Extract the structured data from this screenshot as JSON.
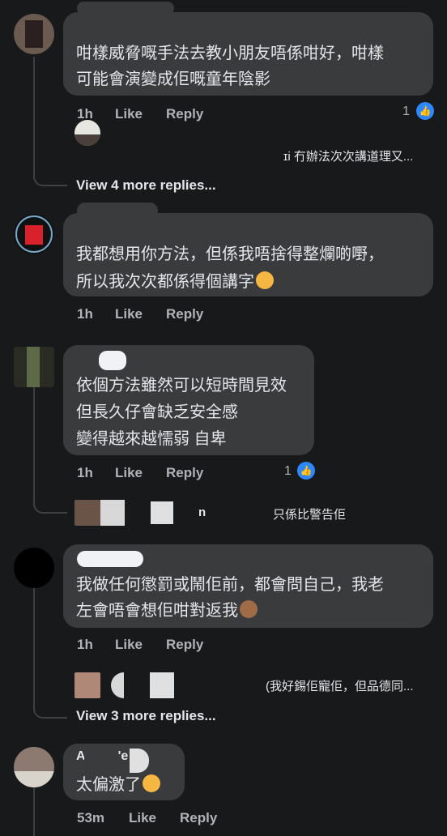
{
  "comments": [
    {
      "lines": [
        "咁樣威脅嘅手法去教小朋友唔係咁好，咁樣",
        "可能會演變成佢嘅童年陰影"
      ],
      "time": "1h",
      "like": "Like",
      "reply": "Reply",
      "reactions": "1",
      "reply_snippet": "ɪi 冇辦法次次講道理又...",
      "view_more": "View 4 more replies..."
    },
    {
      "lines": [
        "我都想用你方法，但係我唔捨得整爛啲嘢，",
        "所以我次次都係得個講字"
      ],
      "time": "1h",
      "like": "Like",
      "reply": "Reply"
    },
    {
      "lines": [
        "依個方法雖然可以短時間見效",
        "但長久仔會缺乏安全感",
        "變得越來越懦弱 自卑"
      ],
      "time": "1h",
      "like": "Like",
      "reply": "Reply",
      "reactions": "1",
      "reply_snippet": "只係比警告佢",
      "reply_name_fragment": "n"
    },
    {
      "lines": [
        "我做任何懲罰或鬧佢前，都會問自己，我老",
        "左會唔會想佢咁對返我"
      ],
      "time": "1h",
      "like": "Like",
      "reply": "Reply",
      "reply_snippet": "(我好錫佢寵佢，但品德同...",
      "view_more": "View 3 more replies..."
    },
    {
      "name_fragment": "A",
      "name_fragment2": "'e",
      "lines": [
        "太偏激了"
      ],
      "time": "53m",
      "like": "Like",
      "reply": "Reply"
    }
  ],
  "colors": {
    "background": "#18191a",
    "bubble": "#3a3b3c",
    "text": "#e4e6eb",
    "meta": "#b0b3b8",
    "like_blue": "#2d88ff"
  },
  "icons": [
    "thumbs-up-icon",
    "smiling-face-emoji",
    "see-no-evil-monkey-emoji",
    "pleading-face-emoji"
  ]
}
